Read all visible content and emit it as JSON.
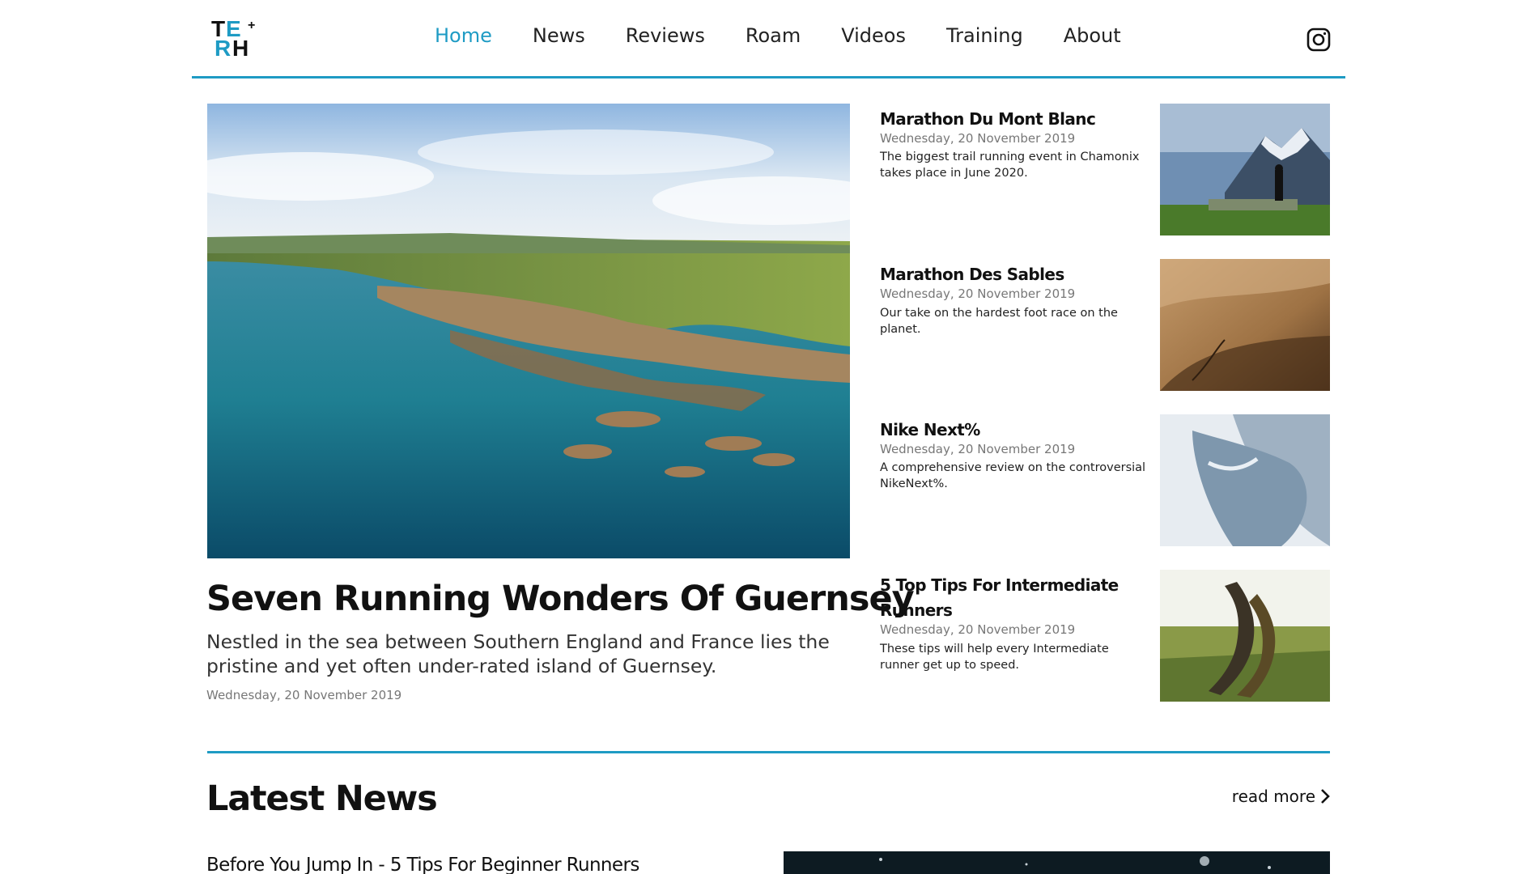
{
  "header": {
    "logo_letters": [
      "T",
      "E",
      "R",
      "H",
      "+"
    ],
    "nav": [
      {
        "label": "Home",
        "active": true
      },
      {
        "label": "News",
        "active": false
      },
      {
        "label": "Reviews",
        "active": false
      },
      {
        "label": "Roam",
        "active": false
      },
      {
        "label": "Videos",
        "active": false
      },
      {
        "label": "Training",
        "active": false
      },
      {
        "label": "About",
        "active": false
      }
    ],
    "social_icon": "instagram-icon"
  },
  "hero": {
    "title": "Seven Running Wonders Of Guernsey",
    "description": "Nestled in the sea between Southern England and France lies the pristine and yet often under-rated island of Guernsey.",
    "date": "Wednesday, 20 November 2019"
  },
  "side_articles": [
    {
      "title": "Marathon Du Mont Blanc",
      "date": "Wednesday, 20 November 2019",
      "description": "The biggest trail running event in Chamonix takes place in June 2020."
    },
    {
      "title": "Marathon Des Sables",
      "date": "Wednesday, 20 November 2019",
      "description": "Our take on the hardest foot race on the planet."
    },
    {
      "title": "Nike Next%",
      "date": "Wednesday, 20 November 2019",
      "description": "A comprehensive review on the controversial NikeNext%."
    },
    {
      "title": "5 Top Tips For Intermediate Runners",
      "date": "Wednesday, 20 November 2019",
      "description": "These tips will help every Intermediate runner get up to speed."
    }
  ],
  "latest": {
    "heading": "Latest News",
    "read_more": "read more",
    "first_article_title": "Before You Jump In - 5 Tips For Beginner Runners"
  },
  "colors": {
    "accent": "#1e9bc4",
    "text": "#111111",
    "muted": "#777777"
  }
}
